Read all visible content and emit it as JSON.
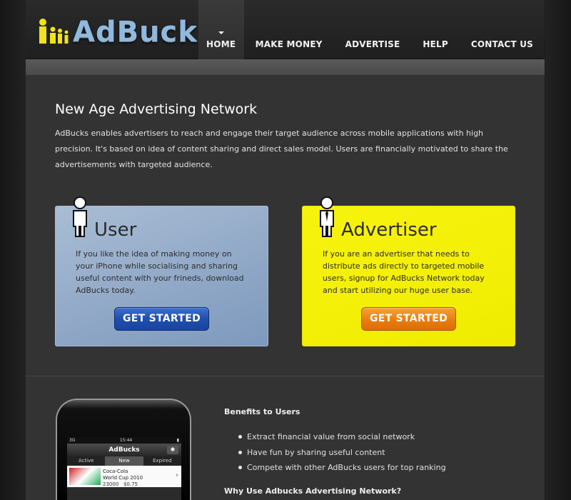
{
  "brand": {
    "name": "AdBuck",
    "dollar": "$"
  },
  "nav": {
    "items": [
      {
        "label": "HOME",
        "active": true
      },
      {
        "label": "MAKE MONEY"
      },
      {
        "label": "ADVERTISE"
      },
      {
        "label": "HELP"
      },
      {
        "label": "CONTACT US"
      }
    ]
  },
  "intro": {
    "title": "New Age Advertising Network",
    "body": "AdBucks enables advertisers to reach and engage their target audience across mobile applications with high precision. It's based on idea of content sharing and direct sales model. Users are financially motivated to share the advertisements with targeted audience."
  },
  "cards": {
    "user": {
      "title": "User",
      "body": "If you like the idea of making money on your iPhone while socialising and sharing useful content with your frineds, download AdBucks today.",
      "cta": "GET STARTED"
    },
    "advertiser": {
      "title": "Advertiser",
      "body": "If you are an advertiser that needs to distribute ads directly to targeted mobile users, signup for AdBucks Network today and start utilizing our huge user base.",
      "cta": "GET STARTED"
    }
  },
  "phone": {
    "carrier": "3G",
    "time": "15:44",
    "title": "AdBucks",
    "bt_icon": "bluetooth-icon",
    "tabs": [
      "Active",
      "New",
      "Expired"
    ],
    "active_tab": "New",
    "item": {
      "title_line1": "Coca-Cola",
      "title_line2": "World Cup 2010",
      "count": "23000",
      "price": "$0.75"
    }
  },
  "benefits": {
    "title": "Benefits to Users",
    "items": [
      "Extract financial value from social network",
      "Have fun by sharing useful content",
      "Compete with other AdBucks users for top ranking"
    ]
  },
  "why_title": "Why Use Adbucks Advertising Network?",
  "colors": {
    "user_card": "#9fb4cf",
    "advertiser_card": "#f3ef06",
    "cta_blue": "#1f4fae",
    "cta_orange": "#e87d0e",
    "logo_blue": "#8fb9df",
    "logo_yellow": "#f0e21c"
  }
}
